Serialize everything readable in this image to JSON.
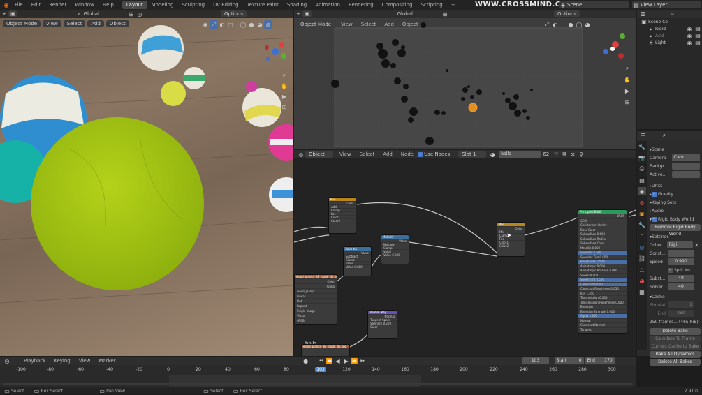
{
  "topbar": {
    "menus": [
      "File",
      "Edit",
      "Render",
      "Window",
      "Help"
    ],
    "workspaces": [
      "Layout",
      "Modeling",
      "Sculpting",
      "UV Editing",
      "Texture Paint",
      "Shading",
      "Animation",
      "Rendering",
      "Compositing",
      "Scripting"
    ],
    "active_workspace": "Layout",
    "add_tab": "+",
    "watermark": "WWW.CROSSMIND.COM",
    "scene": "Scene",
    "view_layer": "View Layer"
  },
  "left_view": {
    "transform": "Global",
    "options": "Options",
    "mode": "Object Mode",
    "menus": [
      "View",
      "Select",
      "Add",
      "Object"
    ]
  },
  "right_view": {
    "transform": "Global",
    "options": "Options",
    "mode": "Object Mode",
    "menus": [
      "View",
      "Select",
      "Add",
      "Object"
    ]
  },
  "outliner": {
    "items": [
      "Scene Co",
      "Rigid",
      "Acid",
      "Light"
    ]
  },
  "node_editor": {
    "type": "Object",
    "menus": [
      "View",
      "Select",
      "Add",
      "Node"
    ],
    "use_nodes": "Use Nodes",
    "slot": "Slot 1",
    "material": "balls",
    "users": "62",
    "frame_label": "balls",
    "nodes": {
      "mix": "Mix",
      "multiply": "Multiply",
      "subtract": "Subtract",
      "mix2": "Mix",
      "bsdf": "Principled BSDF",
      "normal": "Normal Map",
      "image": "wood_planks_08_rough_4k.png"
    },
    "mix_rows": [
      "Color",
      "Add",
      "Clamp",
      "Fac",
      "Color1",
      "Color2"
    ],
    "multiply_rows": [
      "Value",
      "Multiply",
      "Clamp",
      "Value",
      "Value   2.000"
    ],
    "subtract_rows": [
      "Value",
      "Subtract",
      "Clamp",
      "Value",
      "Value   0.800"
    ],
    "mix2_rows": [
      "Color",
      "Mix",
      "Clamp",
      "Fac",
      "Color1",
      "Color2"
    ],
    "bsdf_rows": [
      "BSDF",
      "GGX",
      "Christensen-Burley",
      "Base Color",
      "Subsurface      0.000",
      "Subsurface Radius",
      "Subsurface Color",
      "Metallic        0.000",
      "Specular        0.500",
      "Specular Tint   0.000",
      "Roughness       0.500",
      "Anisotropic     0.000",
      "Anisotropic Rotation 0.000",
      "Sheen           0.000",
      "Sheen Tint      0.500",
      "Clearcoat       0.000",
      "Clearcoat Roughness 0.030",
      "IOR             1.450",
      "Transmission    0.000",
      "Transmission Roughness 0.000",
      "Emission",
      "Emission Strength 1.000",
      "Alpha           1.000",
      "Normal",
      "Clearcoat Normal",
      "Tangent"
    ],
    "normal_rows": [
      "Normal",
      "Tangent Space",
      "Strength   0.200",
      "Color"
    ],
    "image_rows": [
      "Color",
      "Alpha",
      "wood_planks",
      "Linear",
      "Flat",
      "Repeat",
      "Single Image",
      "Vector",
      "sRGB"
    ]
  },
  "properties": {
    "section": "Scene",
    "camera_label": "Camera",
    "camera_value": "Cam...",
    "background_label": "Backgr...",
    "active_label": "Active...",
    "panels": [
      "Units",
      "Gravity",
      "Keying Sets",
      "Audio",
      "Rigid Body World"
    ],
    "remove_btn": "Remove Rigid Body World",
    "settings": "Settings",
    "collection_label": "Collec...",
    "collection_value": "Rigi",
    "constraints_label": "Const...",
    "speed_label": "Speed",
    "speed_value": "0.990",
    "split_label": "Split Im...",
    "substeps_label": "Subst...",
    "substeps_value": "40",
    "solver_label": "Solver...",
    "solver_value": "40",
    "cache": "Cache",
    "sim_label": "Simulat...",
    "sim_value": "1",
    "end_label": "End",
    "end_value": "250",
    "frames_info": "250 frames... (465 KiB).",
    "buttons": [
      "Delete Bake",
      "Calculate To Frame",
      "Current Cache to Bake",
      "Bake All Dynamics",
      "Delete All Bakes"
    ]
  },
  "timeline": {
    "menus": [
      "Playback",
      "Keying",
      "View",
      "Marker"
    ],
    "current_frame": "103",
    "start_label": "Start",
    "start": "0",
    "end_label": "End",
    "end": "170",
    "ruler": [
      "-100",
      "-80",
      "-60",
      "-40",
      "-20",
      "0",
      "20",
      "40",
      "60",
      "80",
      "103",
      "120",
      "140",
      "160",
      "180",
      "200",
      "220",
      "240",
      "260",
      "280",
      "300"
    ]
  },
  "statusbar": {
    "items": [
      "Select",
      "Box Select",
      "Pan View",
      "Select",
      "Box Select"
    ],
    "version": "2.91.0"
  }
}
